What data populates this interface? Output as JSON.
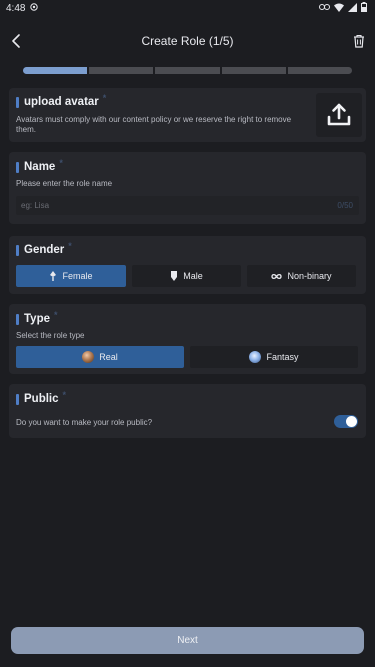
{
  "status_bar": {
    "time": "4:48"
  },
  "app_bar": {
    "title": "Create Role (1/5)"
  },
  "progress": {
    "total_steps": 5,
    "current_step": 1
  },
  "avatar_section": {
    "title": "upload avatar",
    "required_mark": "*",
    "description": "Avatars must comply with our content policy or we reserve the right to remove them."
  },
  "name_section": {
    "title": "Name",
    "required_mark": "*",
    "subtitle": "Please enter the role name",
    "placeholder": "eg: Lisa",
    "value": "",
    "counter": "0/50"
  },
  "gender_section": {
    "title": "Gender",
    "required_mark": "*",
    "options": [
      {
        "label": "Female",
        "icon": "female-icon",
        "selected": true
      },
      {
        "label": "Male",
        "icon": "male-icon",
        "selected": false
      },
      {
        "label": "Non-binary",
        "icon": "infinity-icon",
        "selected": false
      }
    ]
  },
  "type_section": {
    "title": "Type",
    "required_mark": "*",
    "subtitle": "Select the role type",
    "options": [
      {
        "label": "Real",
        "icon": "real-avatar-icon",
        "selected": true
      },
      {
        "label": "Fantasy",
        "icon": "fantasy-avatar-icon",
        "selected": false
      }
    ]
  },
  "public_section": {
    "title": "Public",
    "required_mark": "*",
    "question": "Do you want to make your role public?",
    "enabled": true
  },
  "footer": {
    "next_label": "Next"
  },
  "colors": {
    "accent": "#2f5f99",
    "progress_active": "#7c9ecf",
    "card_bg": "#26272c",
    "page_bg": "#1c1d21",
    "next_button": "#8c9bb4"
  }
}
